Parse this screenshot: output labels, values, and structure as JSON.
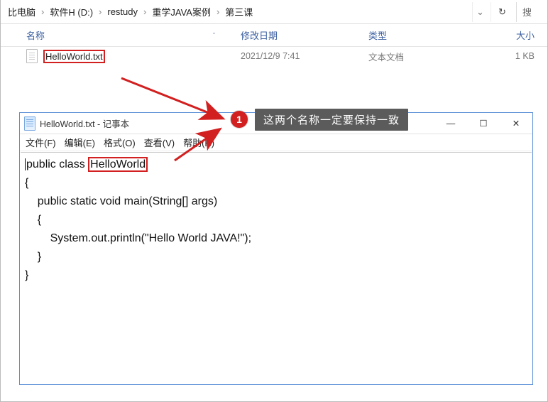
{
  "breadcrumb": {
    "items": [
      "比电脑",
      "软件H (D:)",
      "restudy",
      "重学JAVA案例",
      "第三课"
    ],
    "dropdown_glyph": "⌄",
    "refresh_glyph": "↻",
    "search_glyph": "⌕",
    "search_placeholder": "搜"
  },
  "columns": {
    "name": "名称",
    "date": "修改日期",
    "type": "类型",
    "size": "大小",
    "sort_glyph": "ˆ"
  },
  "files": [
    {
      "name": "HelloWorld.txt",
      "date": "2021/12/9 7:41",
      "type": "文本文档",
      "size": "1 KB"
    }
  ],
  "notepad": {
    "title": "HelloWorld.txt - 记事本",
    "menu": {
      "file": "文件(F)",
      "edit": "编辑(E)",
      "format": "格式(O)",
      "view": "查看(V)",
      "help": "帮助(H)"
    },
    "controls": {
      "min": "—",
      "max": "☐",
      "close": "✕"
    },
    "code": {
      "l1a": "public class ",
      "l1b": "HelloWorld",
      "l2": "{",
      "l3": "    public static void main(String[] args)",
      "l4": "    {",
      "l5": "        System.out.println(\"Hello World JAVA!\");",
      "l6": "    }",
      "l7": "}"
    }
  },
  "annotation": {
    "badge": "1",
    "text": "这两个名称一定要保持一致"
  }
}
